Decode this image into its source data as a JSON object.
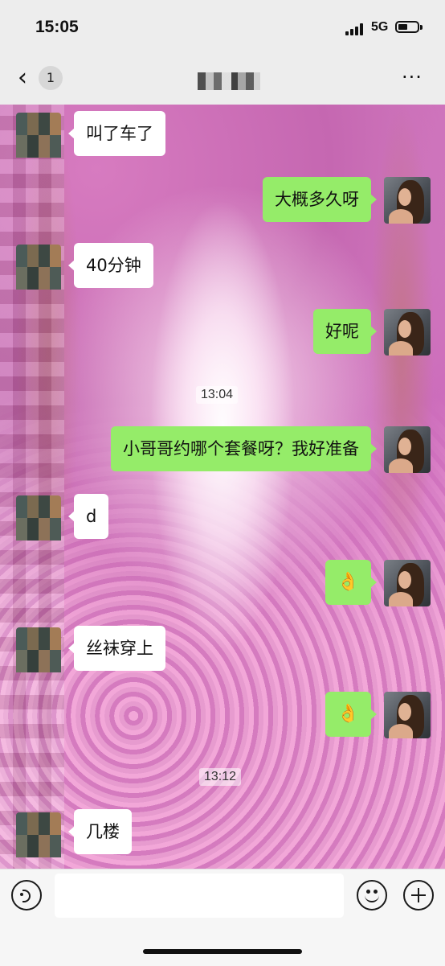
{
  "status_bar": {
    "time": "15:05",
    "network": "5G"
  },
  "nav": {
    "unread_count": "1",
    "contact_name": "▪▪▪▪",
    "more_label": "···"
  },
  "timestamps": {
    "first": "13:04",
    "second": "13:12"
  },
  "messages": [
    {
      "side": "in",
      "text": "叫了车了"
    },
    {
      "side": "out",
      "text": "大概多久呀"
    },
    {
      "side": "in",
      "text": "40分钟"
    },
    {
      "side": "out",
      "text": "好呢"
    },
    {
      "side": "out",
      "text": "小哥哥约哪个套餐呀？我好准备"
    },
    {
      "side": "in",
      "text": "d"
    },
    {
      "side": "out",
      "text": "👌"
    },
    {
      "side": "in",
      "text": "丝袜穿上"
    },
    {
      "side": "out",
      "text": "👌"
    },
    {
      "side": "in",
      "text": "几楼"
    }
  ],
  "icons": {
    "back": "chevron-left-icon",
    "more": "ellipsis-icon",
    "voice": "voice-icon",
    "emoji": "smile-icon",
    "plus": "plus-icon"
  },
  "colors": {
    "outgoing_bubble": "#95ec69",
    "incoming_bubble": "#ffffff",
    "background_theme": "#d884c8"
  }
}
